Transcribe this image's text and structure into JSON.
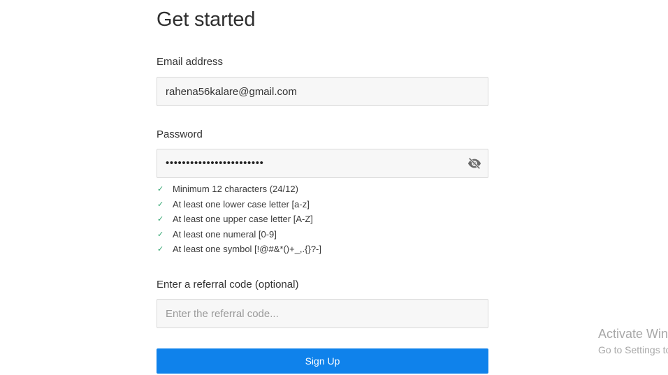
{
  "header": {
    "title": "Get started"
  },
  "email": {
    "label": "Email address",
    "value": "rahena56kalare@gmail.com"
  },
  "password": {
    "label": "Password",
    "masked_value": "••••••••••••••••••••••••",
    "visibility_icon": "eye-slash-icon"
  },
  "password_rules": [
    {
      "icon": "check-icon",
      "text": "Minimum 12 characters (24/12)"
    },
    {
      "icon": "check-icon",
      "text": "At least one lower case letter [a-z]"
    },
    {
      "icon": "check-icon",
      "text": "At least one upper case letter [A-Z]"
    },
    {
      "icon": "check-icon",
      "text": "At least one numeral [0-9]"
    },
    {
      "icon": "check-icon",
      "text": "At least one symbol [!@#&*()+_,.{}?-]"
    }
  ],
  "referral": {
    "label": "Enter a referral code (optional)",
    "placeholder": "Enter the referral code...",
    "value": ""
  },
  "signup_button": {
    "label": "Sign Up"
  },
  "watermark": {
    "title": "Activate Windows",
    "subtitle": "Go to Settings to activate Windows."
  },
  "colors": {
    "primary": "#0f82eb",
    "check": "#2aa36b",
    "field_bg": "#f7f7f7",
    "field_border": "#d9d9d9"
  }
}
